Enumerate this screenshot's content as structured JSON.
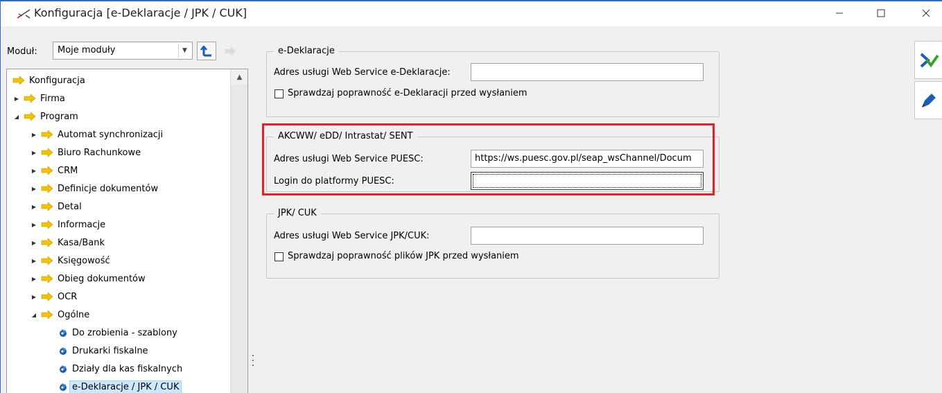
{
  "window": {
    "title": "Konfiguracja [e-Deklaracje / JPK / CUK]",
    "controls": {
      "minimize": "—",
      "maximize": "☐",
      "close": "✕"
    }
  },
  "module": {
    "label": "Moduł:",
    "selected": "Moje moduły"
  },
  "tree": {
    "items": [
      {
        "label": "Konfiguracja",
        "level": 0,
        "expander": "",
        "icon": "folder-arrow-icon"
      },
      {
        "label": "Firma",
        "level": 0,
        "expander": "collapsed",
        "icon": "folder-arrow-icon"
      },
      {
        "label": "Program",
        "level": 0,
        "expander": "expanded",
        "icon": "folder-arrow-icon"
      },
      {
        "label": "Automat synchronizacji",
        "level": 1,
        "expander": "collapsed",
        "icon": "folder-arrow-icon"
      },
      {
        "label": "Biuro Rachunkowe",
        "level": 1,
        "expander": "collapsed",
        "icon": "folder-arrow-icon"
      },
      {
        "label": "CRM",
        "level": 1,
        "expander": "collapsed",
        "icon": "folder-arrow-icon"
      },
      {
        "label": "Definicje dokumentów",
        "level": 1,
        "expander": "collapsed",
        "icon": "folder-arrow-icon"
      },
      {
        "label": "Detal",
        "level": 1,
        "expander": "collapsed",
        "icon": "folder-arrow-icon"
      },
      {
        "label": "Informacje",
        "level": 1,
        "expander": "collapsed",
        "icon": "folder-arrow-icon"
      },
      {
        "label": "Kasa/Bank",
        "level": 1,
        "expander": "collapsed",
        "icon": "folder-arrow-icon"
      },
      {
        "label": "Księgowość",
        "level": 1,
        "expander": "collapsed",
        "icon": "folder-arrow-icon"
      },
      {
        "label": "Obieg dokumentów",
        "level": 1,
        "expander": "collapsed",
        "icon": "folder-arrow-icon"
      },
      {
        "label": "OCR",
        "level": 1,
        "expander": "collapsed",
        "icon": "folder-arrow-icon"
      },
      {
        "label": "Ogólne",
        "level": 1,
        "expander": "expanded",
        "icon": "folder-arrow-icon"
      },
      {
        "label": "Do zrobienia - szablony",
        "level": 2,
        "expander": "",
        "icon": "settings-leaf-icon"
      },
      {
        "label": "Drukarki fiskalne",
        "level": 2,
        "expander": "",
        "icon": "settings-leaf-icon"
      },
      {
        "label": "Działy dla kas fiskalnych",
        "level": 2,
        "expander": "",
        "icon": "settings-leaf-icon"
      },
      {
        "label": "e-Deklaracje / JPK / CUK",
        "level": 2,
        "expander": "",
        "icon": "settings-leaf-icon",
        "selected": true
      }
    ]
  },
  "groups": {
    "edeklaracje": {
      "title": "e-Deklaracje",
      "address_label": "Adres usługi Web Service e-Deklaracje:",
      "address_value": "",
      "check_label": "Sprawdzaj poprawność e-Deklaracji przed wysłaniem",
      "checked": false
    },
    "akcww": {
      "title": "AKCWW/ eDD/ Intrastat/ SENT",
      "address_label": "Adres usługi Web Service PUESC:",
      "address_value": "https://ws.puesc.gov.pl/seap_wsChannel/Docum",
      "login_label": "Login do platformy PUESC:",
      "login_value": ""
    },
    "jpk": {
      "title": "JPK/ CUK",
      "address_label": "Adres usługi Web Service JPK/CUK:",
      "address_value": "",
      "check_label": "Sprawdzaj poprawność plików JPK przed wysłaniem",
      "checked": false
    }
  },
  "colors": {
    "highlight": "#e0202a",
    "selection": "#cce8ff",
    "folder": "#f2c200",
    "accent": "#1a5fb4"
  }
}
